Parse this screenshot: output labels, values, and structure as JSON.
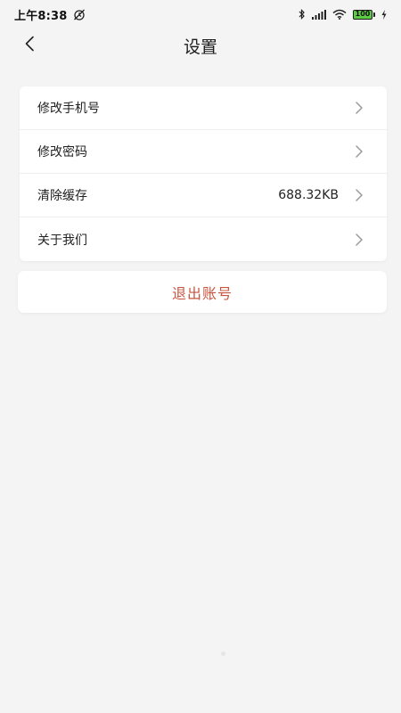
{
  "status_bar": {
    "time": "上午8:38",
    "battery_level": "100",
    "icons": [
      "alarm-off-icon",
      "bluetooth-icon",
      "signal-icon",
      "wifi-icon",
      "battery-icon",
      "charging-icon"
    ]
  },
  "header": {
    "title": "设置",
    "back_icon": "chevron-left-icon"
  },
  "settings": {
    "items": [
      {
        "label": "修改手机号",
        "value": ""
      },
      {
        "label": "修改密码",
        "value": ""
      },
      {
        "label": "清除缓存",
        "value": "688.32KB"
      },
      {
        "label": "关于我们",
        "value": ""
      }
    ]
  },
  "logout": {
    "label": "退出账号"
  },
  "colors": {
    "background": "#f4f4f4",
    "card": "#ffffff",
    "logout_text": "#c8553f",
    "battery_fill": "#5dcc45"
  }
}
